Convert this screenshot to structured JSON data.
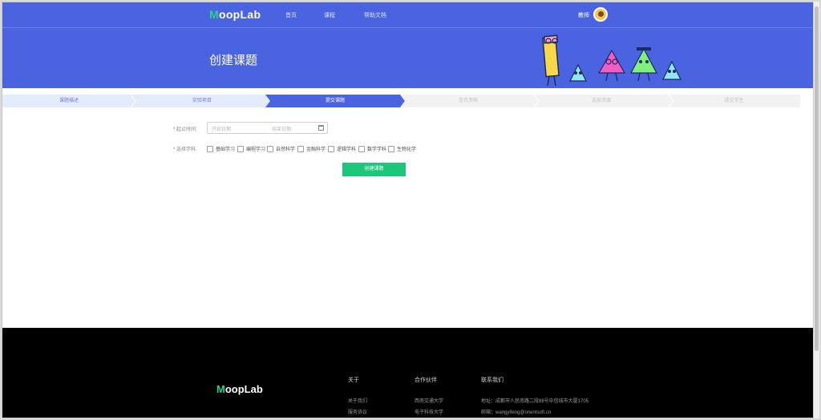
{
  "header": {
    "logo_m": "M",
    "logo_rest": "oopLab",
    "nav": [
      "首页",
      "课程",
      "帮助文档"
    ],
    "user_name": "教师"
  },
  "banner": {
    "title": "创建课题"
  },
  "steps": [
    {
      "label": "课题描述",
      "state": "done"
    },
    {
      "label": "实验项目",
      "state": "done"
    },
    {
      "label": "提交课题",
      "state": "active"
    },
    {
      "label": "签名资格",
      "state": "todo"
    },
    {
      "label": "选择资源",
      "state": "todo"
    },
    {
      "label": "提交学生",
      "state": "todo"
    }
  ],
  "form": {
    "time_label": "起止时间:",
    "start_placeholder": "开始日期",
    "end_placeholder": "结束日期",
    "subject_label": "选择学科:",
    "subjects": [
      "基础学习",
      "编程学习",
      "自然科学",
      "金融科学",
      "逻辑学科",
      "数学学科",
      "生物化学"
    ],
    "submit_label": "创建课题"
  },
  "footer": {
    "logo_m": "M",
    "logo_rest": "oopLab",
    "columns": [
      {
        "title": "关于",
        "links": [
          "关于我们",
          "服务协议"
        ]
      },
      {
        "title": "合作伙伴",
        "links": [
          "西南交通大学",
          "电子科技大学"
        ]
      },
      {
        "title": "联系我们",
        "links": [
          "地址：成都市人民南路二段88号中信城市大厦1705",
          "邮箱：wangyifeng@orientsoft.cn"
        ]
      }
    ]
  },
  "colors": {
    "brand": "#4a63e0",
    "accent": "#1cc77a",
    "step_done": "#e4ecfb",
    "step_active": "#4a63e0",
    "step_todo": "#f2f2f2"
  }
}
